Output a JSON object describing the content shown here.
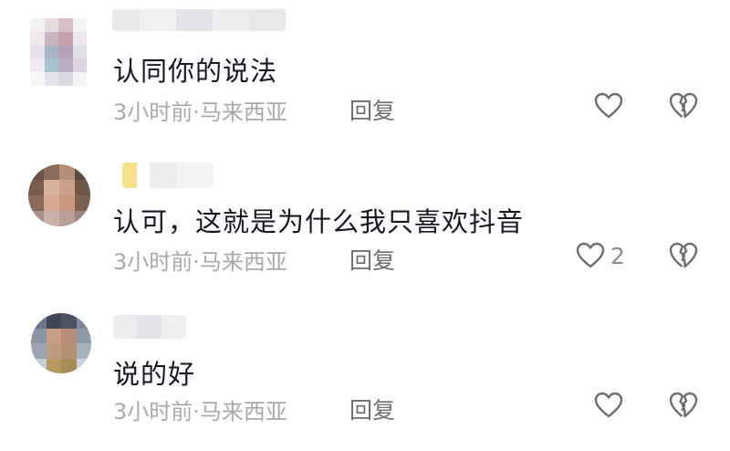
{
  "comments": [
    {
      "text": "认同你的说法",
      "time": "3小时前",
      "separator": "·",
      "location": "马来西亚",
      "reply_label": "回复",
      "like_count": ""
    },
    {
      "text": "认可，这就是为什么我只喜欢抖音",
      "time": "3小时前",
      "separator": "·",
      "location": "马来西亚",
      "reply_label": "回复",
      "like_count": "2"
    },
    {
      "text": "说的好",
      "time": "3小时前",
      "separator": "·",
      "location": "马来西亚",
      "reply_label": "回复",
      "like_count": ""
    }
  ],
  "icons": {
    "like": "heart-outline-icon",
    "dislike": "broken-heart-icon"
  },
  "colors": {
    "text": "#161823",
    "meta": "#a9a9ad",
    "reply": "#6d6e73",
    "icon": "#6d6e73"
  }
}
